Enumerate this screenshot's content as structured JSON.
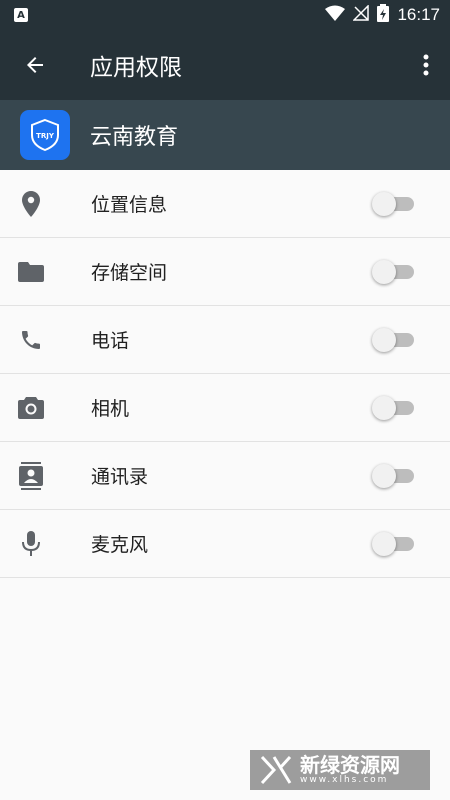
{
  "status_bar": {
    "app_badge": "A",
    "time": "16:17"
  },
  "toolbar": {
    "title": "应用权限"
  },
  "app": {
    "name": "云南教育",
    "logo_text": "TRJY",
    "logo_color": "#1e73f0"
  },
  "permissions": [
    {
      "label": "位置信息",
      "icon": "location-icon",
      "enabled": false
    },
    {
      "label": "存储空间",
      "icon": "folder-icon",
      "enabled": false
    },
    {
      "label": "电话",
      "icon": "phone-icon",
      "enabled": false
    },
    {
      "label": "相机",
      "icon": "camera-icon",
      "enabled": false
    },
    {
      "label": "通讯录",
      "icon": "contacts-icon",
      "enabled": false
    },
    {
      "label": "麦克风",
      "icon": "microphone-icon",
      "enabled": false
    }
  ],
  "watermark": {
    "text": "新绿资源网",
    "url": "www.xlhs.com"
  },
  "colors": {
    "toolbar": "#263238",
    "app_header": "#37474f",
    "icon_gray": "#5f6368"
  }
}
